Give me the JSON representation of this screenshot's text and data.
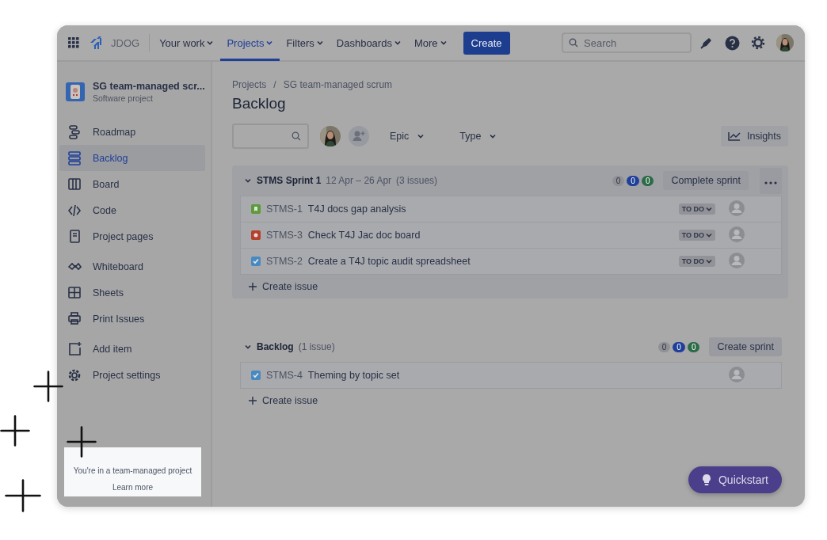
{
  "top_nav": {
    "site": "JDOG",
    "items": [
      {
        "label": "Your work",
        "selected": false
      },
      {
        "label": "Projects",
        "selected": true
      },
      {
        "label": "Filters",
        "selected": false
      },
      {
        "label": "Dashboards",
        "selected": false
      },
      {
        "label": "More",
        "selected": false
      }
    ],
    "create_button": "Create",
    "search": {
      "placeholder": "Search"
    }
  },
  "sidebar": {
    "project": {
      "name": "SG team-managed scr...",
      "type": "Software project"
    },
    "sections": [
      {
        "items": [
          {
            "label": "Roadmap",
            "selected": false
          },
          {
            "label": "Backlog",
            "selected": true
          },
          {
            "label": "Board",
            "selected": false
          },
          {
            "label": "Code",
            "selected": false
          },
          {
            "label": "Project pages",
            "selected": false
          }
        ]
      },
      {
        "items": [
          {
            "label": "Whiteboard",
            "selected": false
          },
          {
            "label": "Sheets",
            "selected": false
          },
          {
            "label": "Print Issues",
            "selected": false
          }
        ]
      },
      {
        "items": [
          {
            "label": "Add item",
            "selected": false
          },
          {
            "label": "Project settings",
            "selected": false
          }
        ]
      }
    ],
    "info": {
      "text": "You're in a team-managed project",
      "link": "Learn more"
    }
  },
  "breadcrumb": {
    "items": [
      "Projects",
      "SG team-managed scrum"
    ],
    "separator": "/"
  },
  "title": "Backlog",
  "filters": {
    "epic": "Epic",
    "type": "Type",
    "insights": "Insights"
  },
  "sprint": {
    "name": "STMS Sprint 1",
    "dates": "12 Apr – 26 Apr",
    "count": "(3 issues)",
    "action": "Complete sprint",
    "badges": [
      {
        "value": "0",
        "color": "#909196"
      },
      {
        "value": "0",
        "color": "#1f3f99"
      },
      {
        "value": "0",
        "color": "#2c6b47"
      }
    ],
    "issues": [
      {
        "kind": "story",
        "key": "STMS-1",
        "summary": "T4J docs gap analysis",
        "status": "TO DO"
      },
      {
        "kind": "bug",
        "key": "STMS-3",
        "summary": "Check T4J Jac doc board",
        "status": "TO DO"
      },
      {
        "kind": "task",
        "key": "STMS-2",
        "summary": "Create a T4J topic audit spreadsheet",
        "status": "TO DO"
      }
    ],
    "create": "Create issue"
  },
  "backlog": {
    "name": "Backlog",
    "count": "(1 issue)",
    "action": "Create sprint",
    "badges": [
      {
        "value": "0",
        "color": "#909196"
      },
      {
        "value": "0",
        "color": "#1f3f99"
      },
      {
        "value": "0",
        "color": "#2c6b47"
      }
    ],
    "issues": [
      {
        "kind": "task",
        "key": "STMS-4",
        "summary": "Theming by topic set"
      }
    ],
    "create": "Create issue"
  },
  "quickstart": "Quickstart"
}
